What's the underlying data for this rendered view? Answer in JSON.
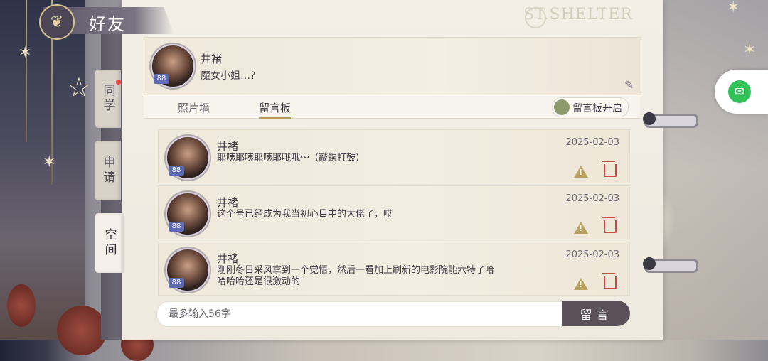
{
  "header": {
    "title": "好友",
    "brand": "ST.SHELTER"
  },
  "side_tabs": [
    {
      "label": "同学",
      "has_notification": true
    },
    {
      "label": "申请",
      "has_notification": false
    },
    {
      "label": "空间",
      "active": true
    }
  ],
  "profile": {
    "name": "井褚",
    "status": "魔女小姐…?",
    "level_badge": "88"
  },
  "tabs": [
    {
      "label": "照片墙",
      "active": false
    },
    {
      "label": "留言板",
      "active": true
    }
  ],
  "board_toggle": {
    "label": "留言板开启",
    "enabled": true
  },
  "messages": [
    {
      "name": "井褚",
      "text": "耶咦耶咦耶咦耶哦哦～（敲螺打鼓）",
      "date": "2025-02-03",
      "badge": "88"
    },
    {
      "name": "井褚",
      "text": "这个号已经成为我当初心目中的大佬了，哎",
      "date": "2025-02-03",
      "badge": "88"
    },
    {
      "name": "井褚",
      "text": "刚刚冬日采风拿到一个觉悟，然后一看加上刷新的电影院能六特了哈哈哈哈还是很激动的",
      "date": "2025-02-03",
      "badge": "88"
    }
  ],
  "input": {
    "placeholder": "最多输入56字",
    "value": ""
  },
  "send_button": {
    "label": "留言"
  },
  "colors": {
    "accent": "#b59a62",
    "send_bg": "#5b5058",
    "delete": "#c84a42",
    "warn": "#b9a15f",
    "wechat": "#33c15a"
  },
  "icons": {
    "edit": "edit-icon",
    "warn": "warning-icon",
    "delete": "trash-icon",
    "wechat": "wechat-icon"
  }
}
